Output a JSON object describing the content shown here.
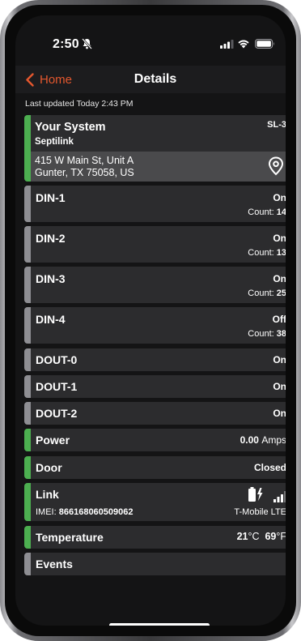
{
  "status_bar": {
    "time": "2:50"
  },
  "nav": {
    "back_label": "Home",
    "title": "Details"
  },
  "last_updated": "Last updated Today 2:43 PM",
  "system": {
    "title": "Your System",
    "brand": "Septilink",
    "code": "SL-3",
    "address_line1": "415 W Main St, Unit A",
    "address_line2": "Gunter, TX 75058, US"
  },
  "inputs": [
    {
      "name": "DIN-1",
      "state": "On",
      "count_label": "Count:",
      "count": "14"
    },
    {
      "name": "DIN-2",
      "state": "On",
      "count_label": "Count:",
      "count": "13"
    },
    {
      "name": "DIN-3",
      "state": "On",
      "count_label": "Count:",
      "count": "25"
    },
    {
      "name": "DIN-4",
      "state": "Off",
      "count_label": "Count:",
      "count": "38"
    }
  ],
  "outputs": [
    {
      "name": "DOUT-0",
      "state": "On"
    },
    {
      "name": "DOUT-1",
      "state": "On"
    },
    {
      "name": "DOUT-2",
      "state": "On"
    }
  ],
  "power": {
    "label": "Power",
    "value": "0.00",
    "unit": "Amps"
  },
  "door": {
    "label": "Door",
    "value": "Closed"
  },
  "link": {
    "label": "Link",
    "imei_label": "IMEI:",
    "imei": "866168060509062",
    "carrier": "T-Mobile LTE"
  },
  "temperature": {
    "label": "Temperature",
    "celsius": "21",
    "celsius_unit": "°C",
    "fahrenheit": "69",
    "fahrenheit_unit": "°F"
  },
  "events": {
    "label": "Events"
  },
  "colors": {
    "accent": "#e4572e",
    "status_green": "#4caf50",
    "status_gray": "#8e8e93",
    "card_bg": "#2c2c2e",
    "screen_bg": "#141415"
  },
  "icons": [
    "bell-slash-icon",
    "cellular-signal-icon",
    "wifi-icon",
    "battery-icon",
    "chevron-left-icon",
    "location-pin-icon",
    "battery-charging-icon",
    "signal-bars-icon"
  ]
}
